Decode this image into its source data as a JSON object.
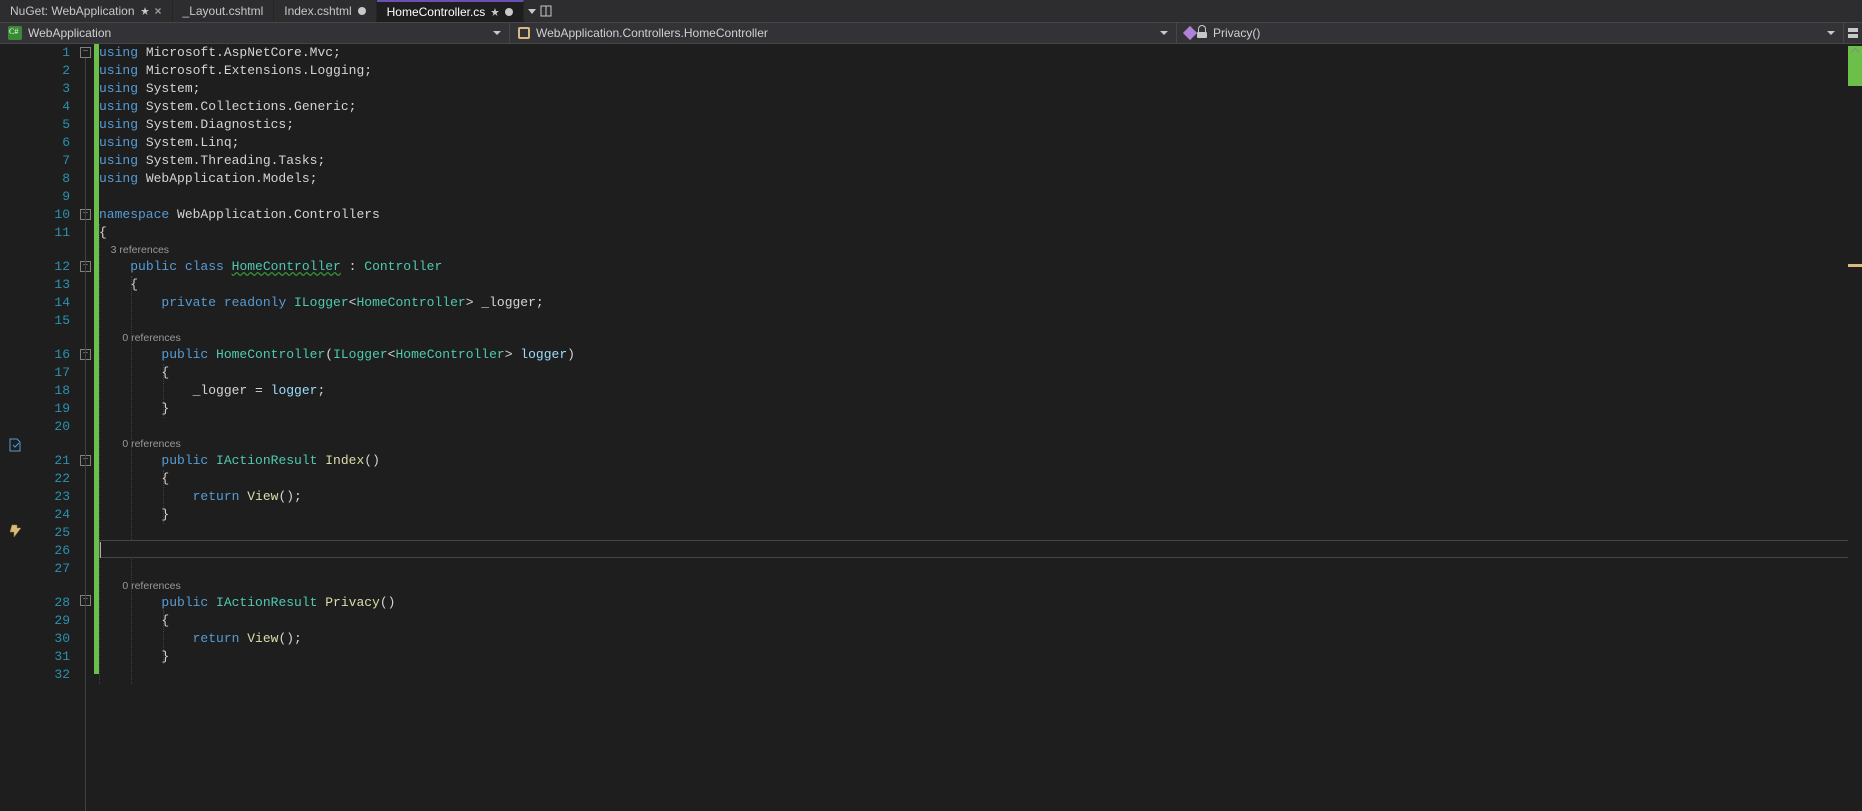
{
  "tabs": [
    {
      "label": "NuGet: WebApplication",
      "pinned": true,
      "closeable": true,
      "active": false,
      "dirty": false
    },
    {
      "label": "_Layout.cshtml",
      "pinned": false,
      "closeable": false,
      "active": false,
      "dirty": false
    },
    {
      "label": "Index.cshtml",
      "pinned": false,
      "closeable": false,
      "active": false,
      "dirty": true
    },
    {
      "label": "HomeController.cs",
      "pinned": true,
      "closeable": false,
      "active": true,
      "dirty": true
    }
  ],
  "nav": {
    "project": "WebApplication",
    "class": "WebApplication.Controllers.HomeController",
    "member": "Privacy()"
  },
  "codelens": {
    "class": "3 references",
    "ctor": "0 references",
    "index": "0 references",
    "privacy": "0 references"
  },
  "gutter_lines": [
    "1",
    "2",
    "3",
    "4",
    "5",
    "6",
    "7",
    "8",
    "9",
    "10",
    "11",
    "",
    "12",
    "13",
    "14",
    "15",
    "",
    "16",
    "17",
    "18",
    "19",
    "20",
    "",
    "21",
    "22",
    "23",
    "24",
    "25",
    "26",
    "27",
    "",
    "28",
    "29",
    "30",
    "31",
    "32"
  ],
  "code": {
    "l1": {
      "kw": "using ",
      "rest": "Microsoft.AspNetCore.Mvc;"
    },
    "l2": {
      "kw": "using ",
      "rest": "Microsoft.Extensions.Logging;"
    },
    "l3": {
      "kw": "using ",
      "rest": "System;"
    },
    "l4": {
      "kw": "using ",
      "rest": "System.Collections.Generic;"
    },
    "l5": {
      "kw": "using ",
      "rest": "System.Diagnostics;"
    },
    "l6": {
      "kw": "using ",
      "rest": "System.Linq;"
    },
    "l7": {
      "kw": "using ",
      "rest": "System.Threading.Tasks;"
    },
    "l8": {
      "kw": "using ",
      "rest": "WebApplication.Models;"
    },
    "l10": {
      "kw": "namespace ",
      "rest": "WebApplication.Controllers"
    },
    "l11": "{",
    "l12": {
      "indent": "    ",
      "kw": "public class ",
      "type": "HomeController",
      "rest": " : ",
      "type2": "Controller"
    },
    "l13": "    {",
    "l14": {
      "indent": "        ",
      "kw": "private readonly ",
      "type": "ILogger",
      "lt": "<",
      "type2": "HomeController",
      "gt": "> ",
      "field": "_logger",
      "semi": ";"
    },
    "l16": {
      "indent": "        ",
      "kw": "public ",
      "ctor": "HomeController",
      "open": "(",
      "ptype": "ILogger",
      "lt": "<",
      "ptype2": "HomeController",
      "gt": "> ",
      "param": "logger",
      ")": ")"
    },
    "l17": "        {",
    "l18": {
      "indent": "            ",
      "lhs": "_logger",
      "eq": " = ",
      "rhs": "logger",
      "semi": ";"
    },
    "l19": "        }",
    "l21": {
      "indent": "        ",
      "kw": "public ",
      "ret": "IActionResult ",
      "name": "Index",
      "paren": "()"
    },
    "l22": "        {",
    "l23": {
      "indent": "            ",
      "kw": "return ",
      "call": "View",
      "paren": "();"
    },
    "l24": "        }",
    "l28": {
      "indent": "        ",
      "kw": "public ",
      "ret": "IActionResult ",
      "name": "Privacy",
      "paren": "()"
    },
    "l29": "        {",
    "l30": {
      "indent": "            ",
      "kw": "return ",
      "call": "View",
      "paren": "();"
    },
    "l31": "        }"
  },
  "colors": {
    "keyword": "#569cd6",
    "type": "#4ec9b0",
    "method": "#dcdcaa",
    "identifier": "#9cdcfe",
    "text": "#d4d4d4",
    "background": "#1e1e1e",
    "linenumber": "#2b91af",
    "changed": "#6cc04a"
  },
  "current_line": 26
}
